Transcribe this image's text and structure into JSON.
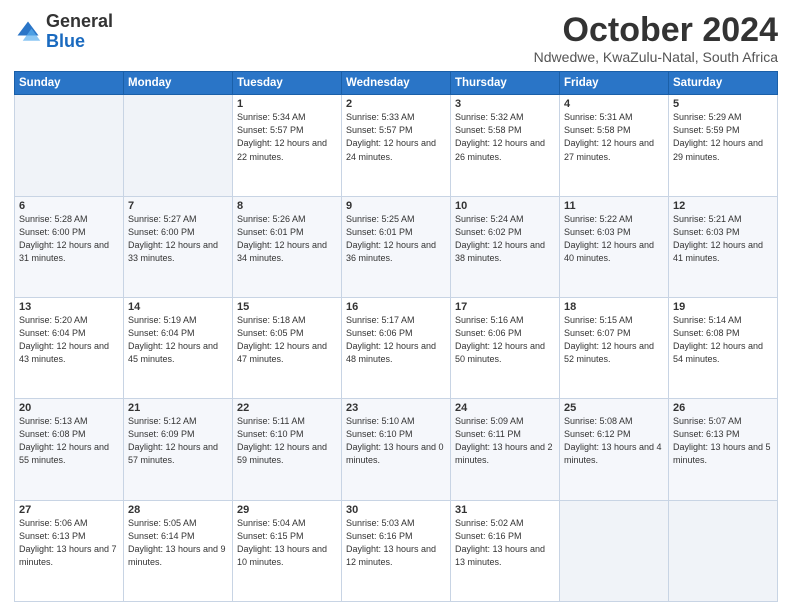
{
  "logo": {
    "general": "General",
    "blue": "Blue"
  },
  "header": {
    "month_year": "October 2024",
    "location": "Ndwedwe, KwaZulu-Natal, South Africa"
  },
  "days_of_week": [
    "Sunday",
    "Monday",
    "Tuesday",
    "Wednesday",
    "Thursday",
    "Friday",
    "Saturday"
  ],
  "weeks": [
    [
      {
        "day": "",
        "empty": true
      },
      {
        "day": "",
        "empty": true
      },
      {
        "day": "1",
        "sunrise": "5:34 AM",
        "sunset": "5:57 PM",
        "daylight": "12 hours and 22 minutes."
      },
      {
        "day": "2",
        "sunrise": "5:33 AM",
        "sunset": "5:57 PM",
        "daylight": "12 hours and 24 minutes."
      },
      {
        "day": "3",
        "sunrise": "5:32 AM",
        "sunset": "5:58 PM",
        "daylight": "12 hours and 26 minutes."
      },
      {
        "day": "4",
        "sunrise": "5:31 AM",
        "sunset": "5:58 PM",
        "daylight": "12 hours and 27 minutes."
      },
      {
        "day": "5",
        "sunrise": "5:29 AM",
        "sunset": "5:59 PM",
        "daylight": "12 hours and 29 minutes."
      }
    ],
    [
      {
        "day": "6",
        "sunrise": "5:28 AM",
        "sunset": "6:00 PM",
        "daylight": "12 hours and 31 minutes."
      },
      {
        "day": "7",
        "sunrise": "5:27 AM",
        "sunset": "6:00 PM",
        "daylight": "12 hours and 33 minutes."
      },
      {
        "day": "8",
        "sunrise": "5:26 AM",
        "sunset": "6:01 PM",
        "daylight": "12 hours and 34 minutes."
      },
      {
        "day": "9",
        "sunrise": "5:25 AM",
        "sunset": "6:01 PM",
        "daylight": "12 hours and 36 minutes."
      },
      {
        "day": "10",
        "sunrise": "5:24 AM",
        "sunset": "6:02 PM",
        "daylight": "12 hours and 38 minutes."
      },
      {
        "day": "11",
        "sunrise": "5:22 AM",
        "sunset": "6:03 PM",
        "daylight": "12 hours and 40 minutes."
      },
      {
        "day": "12",
        "sunrise": "5:21 AM",
        "sunset": "6:03 PM",
        "daylight": "12 hours and 41 minutes."
      }
    ],
    [
      {
        "day": "13",
        "sunrise": "5:20 AM",
        "sunset": "6:04 PM",
        "daylight": "12 hours and 43 minutes."
      },
      {
        "day": "14",
        "sunrise": "5:19 AM",
        "sunset": "6:04 PM",
        "daylight": "12 hours and 45 minutes."
      },
      {
        "day": "15",
        "sunrise": "5:18 AM",
        "sunset": "6:05 PM",
        "daylight": "12 hours and 47 minutes."
      },
      {
        "day": "16",
        "sunrise": "5:17 AM",
        "sunset": "6:06 PM",
        "daylight": "12 hours and 48 minutes."
      },
      {
        "day": "17",
        "sunrise": "5:16 AM",
        "sunset": "6:06 PM",
        "daylight": "12 hours and 50 minutes."
      },
      {
        "day": "18",
        "sunrise": "5:15 AM",
        "sunset": "6:07 PM",
        "daylight": "12 hours and 52 minutes."
      },
      {
        "day": "19",
        "sunrise": "5:14 AM",
        "sunset": "6:08 PM",
        "daylight": "12 hours and 54 minutes."
      }
    ],
    [
      {
        "day": "20",
        "sunrise": "5:13 AM",
        "sunset": "6:08 PM",
        "daylight": "12 hours and 55 minutes."
      },
      {
        "day": "21",
        "sunrise": "5:12 AM",
        "sunset": "6:09 PM",
        "daylight": "12 hours and 57 minutes."
      },
      {
        "day": "22",
        "sunrise": "5:11 AM",
        "sunset": "6:10 PM",
        "daylight": "12 hours and 59 minutes."
      },
      {
        "day": "23",
        "sunrise": "5:10 AM",
        "sunset": "6:10 PM",
        "daylight": "13 hours and 0 minutes."
      },
      {
        "day": "24",
        "sunrise": "5:09 AM",
        "sunset": "6:11 PM",
        "daylight": "13 hours and 2 minutes."
      },
      {
        "day": "25",
        "sunrise": "5:08 AM",
        "sunset": "6:12 PM",
        "daylight": "13 hours and 4 minutes."
      },
      {
        "day": "26",
        "sunrise": "5:07 AM",
        "sunset": "6:13 PM",
        "daylight": "13 hours and 5 minutes."
      }
    ],
    [
      {
        "day": "27",
        "sunrise": "5:06 AM",
        "sunset": "6:13 PM",
        "daylight": "13 hours and 7 minutes."
      },
      {
        "day": "28",
        "sunrise": "5:05 AM",
        "sunset": "6:14 PM",
        "daylight": "13 hours and 9 minutes."
      },
      {
        "day": "29",
        "sunrise": "5:04 AM",
        "sunset": "6:15 PM",
        "daylight": "13 hours and 10 minutes."
      },
      {
        "day": "30",
        "sunrise": "5:03 AM",
        "sunset": "6:16 PM",
        "daylight": "13 hours and 12 minutes."
      },
      {
        "day": "31",
        "sunrise": "5:02 AM",
        "sunset": "6:16 PM",
        "daylight": "13 hours and 13 minutes."
      },
      {
        "day": "",
        "empty": true
      },
      {
        "day": "",
        "empty": true
      }
    ]
  ],
  "labels": {
    "sunrise": "Sunrise:",
    "sunset": "Sunset:",
    "daylight": "Daylight:"
  }
}
